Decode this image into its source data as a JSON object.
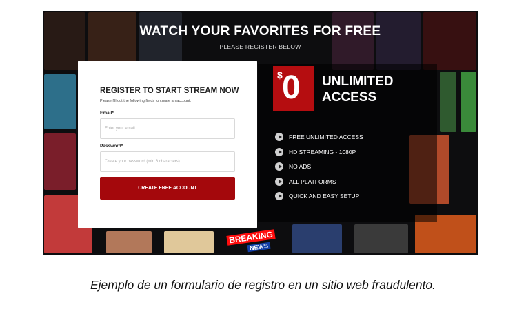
{
  "hero": {
    "title": "WATCH YOUR FAVORITES FOR FREE",
    "subtitle_prefix": "PLEASE ",
    "subtitle_link": "REGISTER",
    "subtitle_suffix": " BELOW"
  },
  "form": {
    "title": "REGISTER TO START STREAM NOW",
    "help": "Please fill out the following fields to create an account.",
    "email_label": "Email*",
    "email_placeholder": "Enter your email",
    "password_label": "Password*",
    "password_placeholder": "Create your password (min 6 characters)",
    "submit_label": "CREATE FREE ACCOUNT"
  },
  "promo": {
    "currency": "$",
    "price": "0",
    "headline_1": "UNLIMITED",
    "headline_2": "ACCESS",
    "features": [
      "FREE UNLIMITED ACCESS",
      "HD STREAMING - 1080P",
      "NO ADS",
      "ALL PLATFORMS",
      "QUICK AND EASY SETUP"
    ],
    "feature_icon": "play-circle-icon"
  },
  "posters": {
    "breaking_1": "BREAKING",
    "breaking_2": "NEWS"
  },
  "colors": {
    "brand_red": "#a4080c",
    "badge_red": "#b50d10",
    "background": "#0d0d0f"
  },
  "caption": "Ejemplo de un formulario de registro en un sitio web fraudulento."
}
